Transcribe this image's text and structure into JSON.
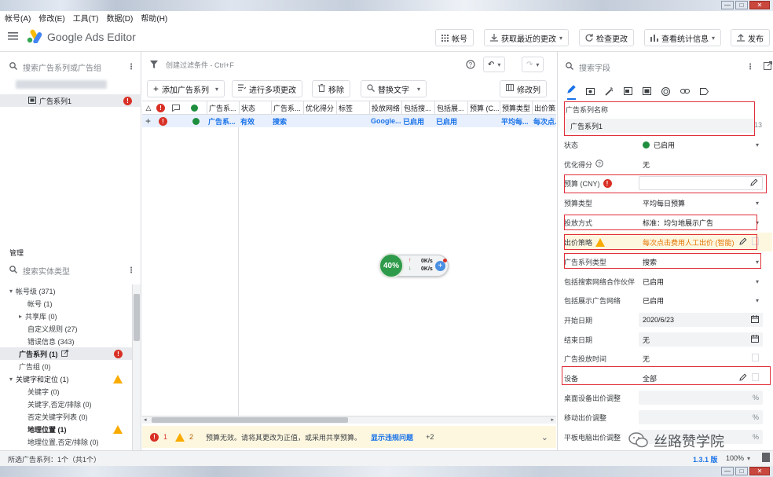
{
  "window": {
    "min": "—",
    "max": "□",
    "close": "✕"
  },
  "menu": [
    "帐号(A)",
    "修改(E)",
    "工具(T)",
    "数据(D)",
    "帮助(H)"
  ],
  "app": {
    "title": "Google Ads Editor",
    "buttons": {
      "account": "帐号",
      "get_changes": "获取最近的更改",
      "check_changes": "检查更改",
      "view_stats": "查看统计信息",
      "publish": "发布"
    }
  },
  "left": {
    "search_placeholder": "搜索广告系列或广告组",
    "campaign_item": "广告系列1",
    "manage_label": "管理",
    "entity_search_placeholder": "搜索实体类型",
    "tree": [
      {
        "label": "帐号级 (371)",
        "indent": 0,
        "expanded": true
      },
      {
        "label": "帐号 (1)",
        "indent": 2
      },
      {
        "label": "共享库 (0)",
        "indent": 1,
        "collapsed": true
      },
      {
        "label": "自定义规则 (27)",
        "indent": 2
      },
      {
        "label": "错误信息 (343)",
        "indent": 2
      },
      {
        "label": "广告系列 (1)",
        "indent": 0,
        "selected": true,
        "error": true
      },
      {
        "label": "广告组 (0)",
        "indent": 0
      },
      {
        "label": "关键字和定位 (1)",
        "indent": 0,
        "expanded": true,
        "warning": true
      },
      {
        "label": "关键字 (0)",
        "indent": 2
      },
      {
        "label": "关键字,否定/排除 (0)",
        "indent": 2
      },
      {
        "label": "否定关键字列表 (0)",
        "indent": 2
      },
      {
        "label": "地理位置 (1)",
        "indent": 2,
        "warning": true,
        "bold": true
      },
      {
        "label": "地理位置,否定/排除 (0)",
        "indent": 2
      }
    ]
  },
  "center": {
    "filter_placeholder": "创建过滤条件 - Ctrl+F",
    "toolbar": {
      "add_campaign": "添加广告系列",
      "multi_edit": "进行多项更改",
      "remove": "移除",
      "replace_text": "替换文字",
      "edit_columns": "修改列"
    },
    "columns": [
      "广告系...",
      "状态",
      "广告系...",
      "优化得分",
      "标签",
      "投放网络",
      "包括搜...",
      "包括展...",
      "预算 (C...",
      "预算类型",
      "出价策..."
    ],
    "row": {
      "name": "广告系...",
      "status": "有效",
      "type": "搜索",
      "network": "Google...",
      "search": "已启用",
      "display": "已启用",
      "budget_type": "平均每...",
      "bid": "每次点..."
    },
    "widget": {
      "percent": "40%",
      "up": "0K/s",
      "down": "0K/s"
    },
    "error_bar": {
      "errors": "1",
      "warnings": "2",
      "message": "预算无效。请将其更改为正值，或采用共享预算。",
      "link": "显示违规问题",
      "more": "+2"
    }
  },
  "right": {
    "search_placeholder": "搜索字段",
    "fields": {
      "campaign_name_label": "广告系列名称",
      "campaign_name_value": "广告系列1",
      "campaign_name_count": "13",
      "status_label": "状态",
      "status_value": "已启用",
      "opt_label": "优化得分",
      "opt_value": "无",
      "budget_label": "预算 (CNY)",
      "budget_type_label": "预算类型",
      "budget_type_value": "平均每日预算",
      "delivery_label": "投放方式",
      "delivery_value": "标准：均匀地展示广告",
      "bid_label": "出价策略",
      "bid_value": "每次点击费用人工出价 (智能)",
      "campaign_type_label": "广告系列类型",
      "campaign_type_value": "搜索",
      "search_partners_label": "包括搜索网络合作伙伴",
      "search_partners_value": "已启用",
      "display_label": "包括展示广告网络",
      "display_value": "已启用",
      "start_label": "开始日期",
      "start_value": "2020/6/23",
      "end_label": "结束日期",
      "end_value": "无",
      "schedule_label": "广告投放时间",
      "schedule_value": "无",
      "device_label": "设备",
      "device_value": "全部",
      "desktop_label": "桌面设备出价调整",
      "mobile_label": "移动出价调整",
      "tablet_label": "平板电脑出价调整",
      "pct": "%"
    }
  },
  "status": {
    "left": "所选广告系列：1个（共1个）",
    "version": "1.3.1 版",
    "zoom": "100%",
    "watermark": "丝路赞学院"
  },
  "colors": {
    "accent": "#1a73e8",
    "error": "#d93025",
    "warning": "#f9ab00",
    "success": "#1e8e3e",
    "highlight": "#e0303a"
  }
}
